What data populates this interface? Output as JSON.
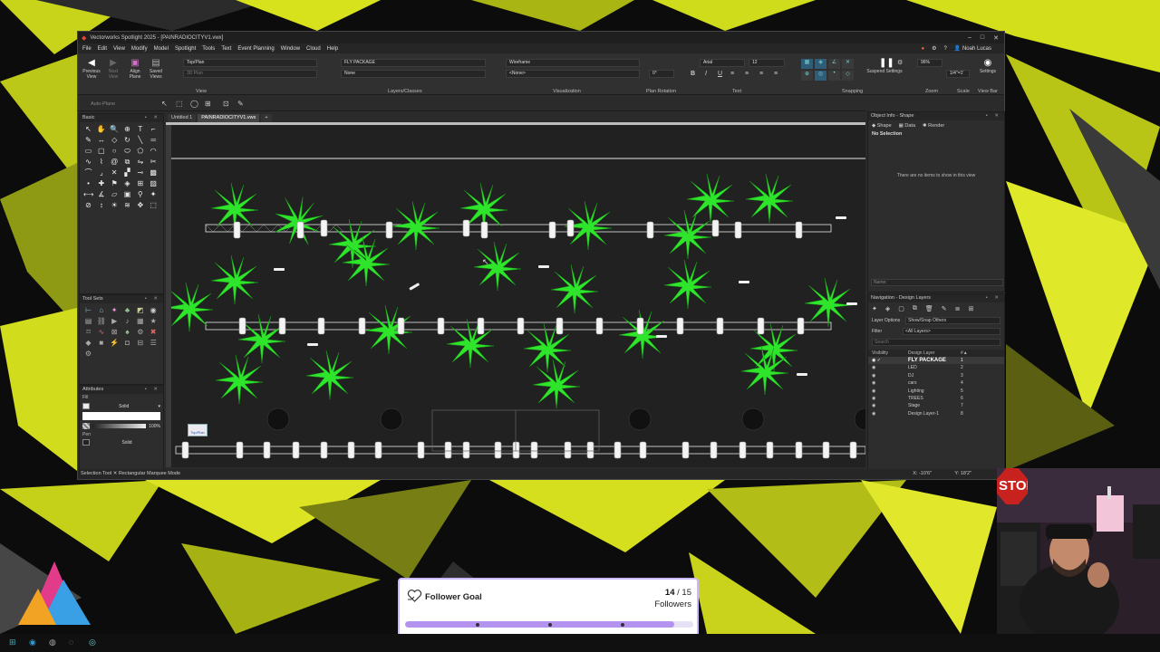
{
  "window": {
    "title": "Vectorworks Spotlight 2025 - [PAINRADIOCITYV1.vwx]",
    "controls": [
      "–",
      "□",
      "✕"
    ]
  },
  "menu": [
    "File",
    "Edit",
    "View",
    "Modify",
    "Model",
    "Spotlight",
    "Tools",
    "Text",
    "Event Planning",
    "Window",
    "Cloud",
    "Help"
  ],
  "user": {
    "name": "Noah Lucas"
  },
  "ribbon": {
    "previous_view": "Previous View",
    "next_view": "Next View",
    "align_plane": "Align Plane",
    "saved_views": "Saved Views",
    "view_dropdown": "Top/Plan",
    "view_dropdown2": "3D Plan",
    "layer_dropdown": "FLY PACKAGE",
    "class_dropdown": "None",
    "render_dropdown": "Wireframe",
    "render_dropdown2": "<None>",
    "rotation_value": "0°",
    "font_name": "Arial",
    "font_size": "12",
    "zoom_value": "96%",
    "scale_value": "1/4\"=1'",
    "suspend_settings": "Suspend Settings",
    "settings": "Settings",
    "groups": {
      "view": "View",
      "layers": "Layers/Classes",
      "visualization": "Visualization",
      "plan_rotation": "Plan Rotation",
      "text": "Text",
      "snapping": "Snapping",
      "zoom": "Zoom",
      "scale": "Scale",
      "view_bar": "View Bar"
    }
  },
  "palettes": {
    "basic": "Basic",
    "tool_sets": "Tool Sets",
    "attributes": "Attributes",
    "fill_label": "Fill",
    "fill_style": "Solid",
    "opacity": "100%",
    "pen_label": "Pen",
    "pen_style": "Solid"
  },
  "auto_plane": "Auto-Plane",
  "doc_tabs": [
    "Untitled 1",
    "PAINRADIOCITYV1.vwx",
    "+"
  ],
  "view_badge": "Top/Plan",
  "status": {
    "tool": "Selection Tool",
    "mode": "Rectangular Marquee Mode",
    "x": "X: -10'6\"",
    "y": "Y: 18'2\""
  },
  "object_info": {
    "title": "Object Info - Shape",
    "tabs": [
      "Shape",
      "Data",
      "Render"
    ],
    "selection": "No Selection",
    "empty_msg": "There are no items to show in this view",
    "name_label": "Name:"
  },
  "navigation": {
    "title": "Navigation - Design Layers",
    "layer_options_label": "Layer Options",
    "layer_options_value": "Show/Snap Others",
    "filter_label": "Filter",
    "filter_value": "<All Layers>",
    "search_placeholder": "Search",
    "col_visibility": "Visibility",
    "col_layer": "Design Layer",
    "layers": [
      {
        "name": "FLY PACKAGE",
        "num": "1",
        "active": true
      },
      {
        "name": "LED",
        "num": "2"
      },
      {
        "name": "DJ",
        "num": "3"
      },
      {
        "name": "cars",
        "num": "4"
      },
      {
        "name": "Lighting",
        "num": "5"
      },
      {
        "name": "TREES",
        "num": "6"
      },
      {
        "name": "Stage",
        "num": "7"
      },
      {
        "name": "Design Layer-1",
        "num": "8"
      }
    ]
  },
  "follower_goal": {
    "label": "Follower Goal",
    "current": "14",
    "separator": " / ",
    "target": "15",
    "unit": "Followers",
    "progress": 0.933
  },
  "stop_sign": "STOP",
  "colors": {
    "accent": "#b493f0",
    "palm": "#2ee52b",
    "bg_yellow": "#d6e31c"
  }
}
